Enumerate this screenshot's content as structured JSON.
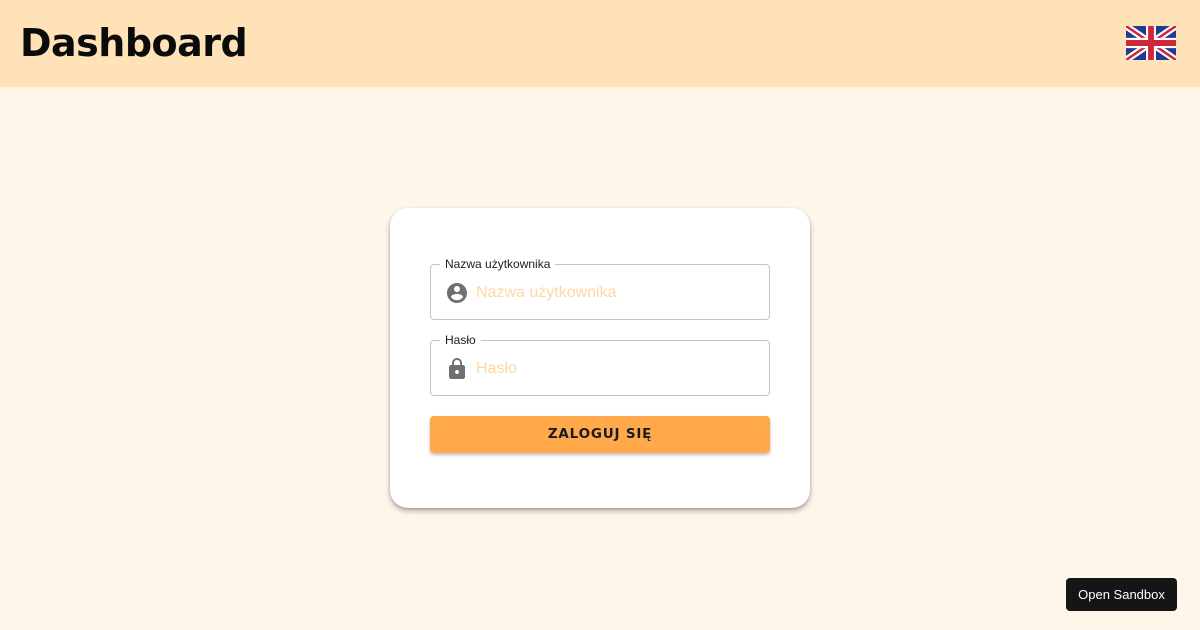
{
  "header": {
    "title": "Dashboard",
    "language_icon": "uk-flag-icon"
  },
  "login_form": {
    "username": {
      "label": "Nazwa użytkownika",
      "placeholder": "Nazwa użytkownika",
      "value": "",
      "icon": "account-circle-icon"
    },
    "password": {
      "label": "Hasło",
      "placeholder": "Hasło",
      "value": "",
      "icon": "lock-icon"
    },
    "submit_label": "ZALOGUJ SIĘ"
  },
  "sandbox": {
    "label": "Open Sandbox"
  },
  "colors": {
    "page_background": "#fff6ea",
    "header_background": "#ffe2b8",
    "accent": "#ffa94a",
    "placeholder": "#ffd7a6"
  }
}
